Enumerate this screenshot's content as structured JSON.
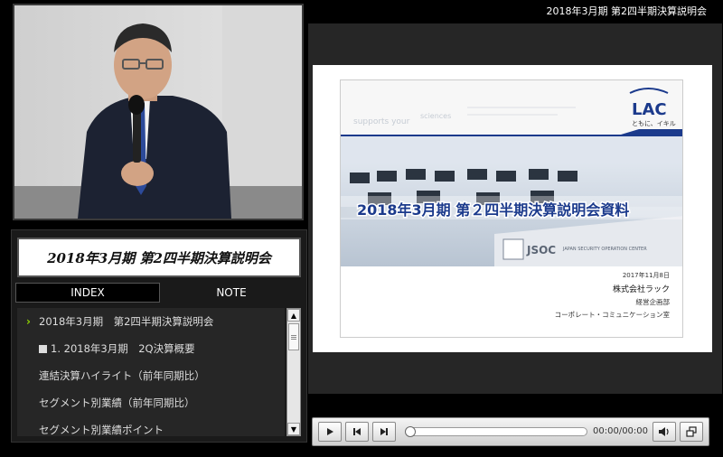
{
  "header": {
    "title": "2018年3月期 第2四半期決算説明会"
  },
  "panel": {
    "title": "2018年3月期 第2四半期決算説明会",
    "tabs": [
      {
        "label": "INDEX",
        "active": true
      },
      {
        "label": "NOTE",
        "active": false
      }
    ],
    "index_items": [
      {
        "label": "2018年3月期　第2四半期決算説明会",
        "current": true
      },
      {
        "label": "1. 2018年3月期　2Q決算概要",
        "bullet": true
      },
      {
        "label": "連結決算ハイライト（前年同期比）"
      },
      {
        "label": "セグメント別業績（前年同期比）"
      },
      {
        "label": "セグメント別業績ポイント"
      }
    ]
  },
  "slide": {
    "logo": "LAC",
    "logo_tagline": "ともに、イキル",
    "banner_title": "2018年3月期 第２四半期決算説明会資料",
    "date": "2017年11月8日",
    "company": "株式会社ラック",
    "department": "経営企画部",
    "section": "コーポレート・コミュニケーション室",
    "sign_main": "JSOC",
    "sign_sub": "JAPAN SECURITY OPERATION CENTER",
    "faint_text_left": "supports your",
    "faint_text_right": "sciences"
  },
  "player": {
    "time": "00:00/00:00"
  },
  "colors": {
    "accent": "#8fd400",
    "logo_blue": "#1b3a8c"
  }
}
